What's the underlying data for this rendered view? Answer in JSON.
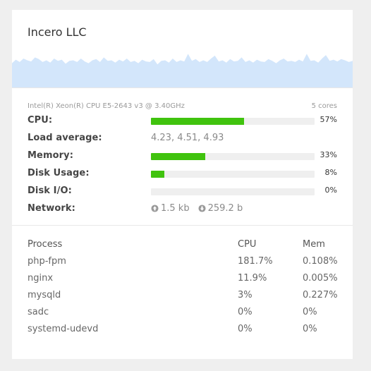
{
  "server": {
    "name": "Incero LLC"
  },
  "sparkline": {
    "color": "#d3e6fb",
    "points": [
      0.42,
      0.48,
      0.44,
      0.5,
      0.47,
      0.45,
      0.52,
      0.49,
      0.44,
      0.47,
      0.43,
      0.5,
      0.46,
      0.48,
      0.41,
      0.46,
      0.47,
      0.44,
      0.5,
      0.45,
      0.42,
      0.47,
      0.49,
      0.44,
      0.52,
      0.46,
      0.47,
      0.43,
      0.48,
      0.45,
      0.5,
      0.44,
      0.46,
      0.42,
      0.48,
      0.45,
      0.44,
      0.49,
      0.4,
      0.46,
      0.47,
      0.43,
      0.5,
      0.44,
      0.47,
      0.45,
      0.58,
      0.46,
      0.49,
      0.44,
      0.47,
      0.44,
      0.5,
      0.55,
      0.45,
      0.47,
      0.43,
      0.49,
      0.45,
      0.46,
      0.52,
      0.44,
      0.47,
      0.43,
      0.48,
      0.45,
      0.44,
      0.49,
      0.46,
      0.42,
      0.47,
      0.5,
      0.45,
      0.46,
      0.44,
      0.48,
      0.45,
      0.58,
      0.46,
      0.47,
      0.43,
      0.5,
      0.56,
      0.46,
      0.48,
      0.45,
      0.49,
      0.47,
      0.44,
      0.46
    ]
  },
  "cpu_model": {
    "text": "Intel(R) Xeon(R) CPU E5-2643 v3 @ 3.40GHz",
    "cores": "5 cores"
  },
  "metrics": {
    "cpu": {
      "label": "CPU:",
      "percent": "57%",
      "fill": 0.57
    },
    "load": {
      "label": "Load average:",
      "value": "4.23, 4.51, 4.93"
    },
    "memory": {
      "label": "Memory:",
      "percent": "33%",
      "fill": 0.33
    },
    "disk_usage": {
      "label": "Disk Usage:",
      "percent": "8%",
      "fill": 0.08
    },
    "disk_io": {
      "label": "Disk I/O:",
      "percent": "0%",
      "fill": 0.0
    },
    "network": {
      "label": "Network:",
      "up": "1.5 kb",
      "down": "259.2 b"
    }
  },
  "bar_color": "#40c30e",
  "processes": {
    "headers": {
      "name": "Process",
      "cpu": "CPU",
      "mem": "Mem"
    },
    "rows": [
      {
        "name": "php-fpm",
        "cpu": "181.7%",
        "mem": "0.108%"
      },
      {
        "name": "nginx",
        "cpu": "11.9%",
        "mem": "0.005%"
      },
      {
        "name": "mysqld",
        "cpu": "3%",
        "mem": "0.227%"
      },
      {
        "name": "sadc",
        "cpu": "0%",
        "mem": "0%"
      },
      {
        "name": "systemd-udevd",
        "cpu": "0%",
        "mem": "0%"
      }
    ]
  }
}
